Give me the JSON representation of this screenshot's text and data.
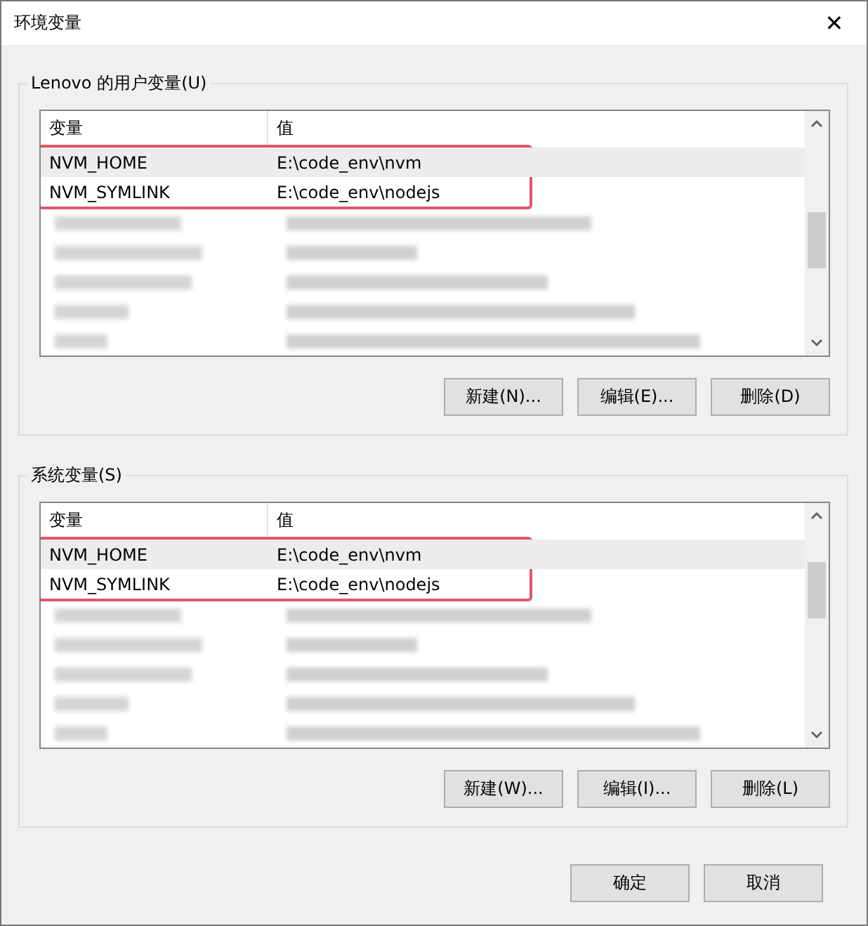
{
  "window": {
    "title": "环境变量",
    "close": "✕"
  },
  "groups": [
    {
      "title": "Lenovo 的用户变量(U)",
      "columns": [
        "变量",
        "值"
      ],
      "rows": [
        {
          "kind": "text",
          "name": "NVM_HOME",
          "value": "E:\\code_env\\nvm",
          "selected": true,
          "marked": true
        },
        {
          "kind": "text",
          "name": "NVM_SYMLINK",
          "value": "E:\\code_env\\nodejs",
          "selected": false,
          "marked": true
        },
        {
          "kind": "redacted"
        },
        {
          "kind": "redacted"
        },
        {
          "kind": "redacted"
        },
        {
          "kind": "redacted"
        },
        {
          "kind": "redacted"
        }
      ],
      "buttons": [
        "新建(N)...",
        "编辑(E)...",
        "删除(D)"
      ]
    },
    {
      "title": "系统变量(S)",
      "columns": [
        "变量",
        "值"
      ],
      "rows": [
        {
          "kind": "text",
          "name": "NVM_HOME",
          "value": "E:\\code_env\\nvm",
          "selected": true,
          "marked": true
        },
        {
          "kind": "text",
          "name": "NVM_SYMLINK",
          "value": "E:\\code_env\\nodejs",
          "selected": false,
          "marked": true
        },
        {
          "kind": "redacted"
        },
        {
          "kind": "redacted"
        },
        {
          "kind": "redacted"
        },
        {
          "kind": "redacted"
        },
        {
          "kind": "redacted"
        }
      ],
      "buttons": [
        "新建(W)...",
        "编辑(I)...",
        "删除(L)"
      ]
    }
  ],
  "buttons": [
    "确定",
    "取消"
  ]
}
